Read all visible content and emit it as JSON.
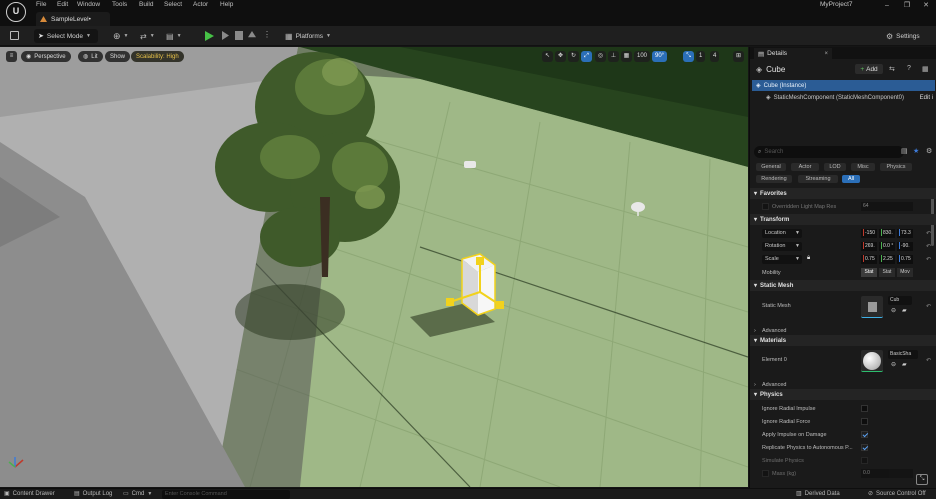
{
  "menu": [
    "File",
    "Edit",
    "Window",
    "Tools",
    "Build",
    "Select",
    "Actor",
    "Help"
  ],
  "project_name": "MyProject7",
  "level_tab": "SampleLevel•",
  "toolbar": {
    "select_mode": "Select Mode",
    "platforms": "Platforms",
    "settings": "Settings"
  },
  "viewport": {
    "perspective": "Perspective",
    "lit": "Lit",
    "show": "Show",
    "scalability": "Scalability: High",
    "grid_snap": "100",
    "rotation_snap": "90°",
    "scale_snap": "1",
    "camera_speed": "4"
  },
  "statusbar": {
    "content_drawer": "Content Drawer",
    "output_log": "Output Log",
    "cmd": "Cmd",
    "console_placeholder": "Enter Console Command",
    "derived_data": "Derived Data",
    "source_control": "Source Control Off"
  },
  "details": {
    "tab_label": "Details",
    "close": "×",
    "actor_name": "Cube",
    "add_label": "Add",
    "components": [
      {
        "label": "Cube (Instance)"
      },
      {
        "label": "StaticMeshComponent (StaticMeshComponent0)",
        "edit": "Edit i"
      }
    ],
    "search_placeholder": "Search",
    "filters_row1": [
      "General",
      "Actor",
      "LOD",
      "Misc",
      "Physics"
    ],
    "filters_row2": [
      "Rendering",
      "Streaming",
      "All"
    ],
    "active_filter": "All",
    "sections": {
      "favorites": "Favorites",
      "transform": "Transform",
      "static_mesh": "Static Mesh",
      "advanced1": "Advanced",
      "materials": "Materials",
      "advanced2": "Advanced",
      "physics": "Physics"
    },
    "favorites_prop": {
      "label": "Overridden Light Map Res",
      "value": "64"
    },
    "transform": {
      "location_label": "Location",
      "location": [
        "-150",
        "830.",
        "73.3"
      ],
      "rotation_label": "Rotation",
      "rotation": [
        "269.",
        "0.0 °",
        "-90."
      ],
      "scale_label": "Scale",
      "scale": [
        "0.75",
        "2.25",
        "0.75"
      ],
      "mobility_label": "Mobility",
      "mobility_options": [
        "Stat",
        "Stat",
        "Mov"
      ]
    },
    "static_mesh": {
      "label": "Static Mesh",
      "asset": "Cub"
    },
    "materials": {
      "label": "Element 0",
      "asset": "BasicSha"
    },
    "physics": [
      {
        "label": "Ignore Radial Impulse",
        "checked": false
      },
      {
        "label": "Ignore Radial Force",
        "checked": false
      },
      {
        "label": "Apply Impulse on Damage",
        "checked": true
      },
      {
        "label": "Replicate Physics to Autonomous P...",
        "checked": true
      },
      {
        "label": "Simulate Physics",
        "checked": false
      }
    ],
    "mass": {
      "label": "Mass (kg)",
      "value": "0.0"
    }
  },
  "colors": {
    "accent_blue": "#2b6fb8",
    "play_green": "#46c146",
    "selection_yellow": "#f2d21c",
    "ground_green": "#9fb887",
    "axis_x": "#c0392b",
    "axis_y": "#4caf50",
    "axis_z": "#3d7bd9"
  }
}
